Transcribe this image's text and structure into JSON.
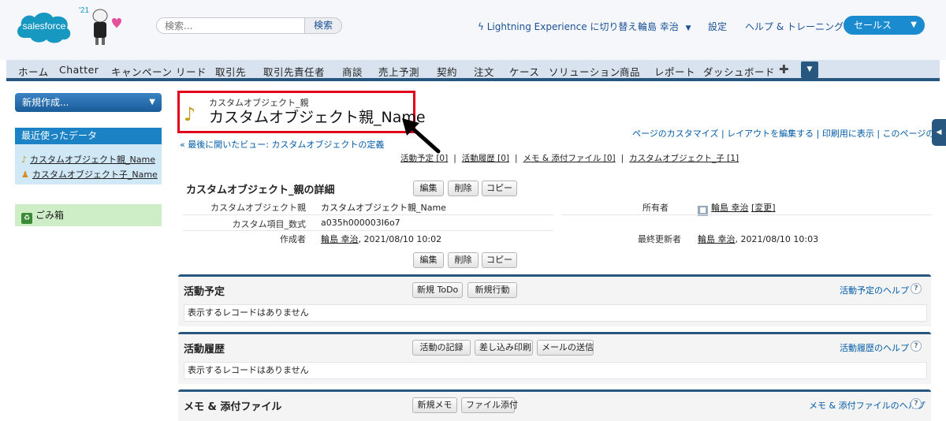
{
  "header": {
    "search_placeholder": "検索...",
    "search_button": "検索",
    "lightning_link": "Lightning Experience に切り替え",
    "user_name": "輪島 幸治",
    "setup": "設定",
    "help_training": "ヘルプ & トレーニング",
    "app_name": "セールス",
    "logo_text": "salesforce",
    "mascot_badge": "'21"
  },
  "tabs": [
    "ホーム",
    "Chatter",
    "キャンペーン",
    "リード",
    "取引先",
    "取引先責任者",
    "商談",
    "売上予測",
    "契約",
    "注文",
    "ケース",
    "ソリューション",
    "商品",
    "レポート",
    "ダッシュボード"
  ],
  "sidebar": {
    "new_label": "新規作成...",
    "recent_title": "最近使ったデータ",
    "recent_items": [
      "カスタムオブジェクト親_Name",
      "カスタムオブジェクト子_Name"
    ],
    "trash_label": "ごみ箱"
  },
  "record": {
    "object_label": "カスタムオブジェクト_親",
    "name": "カスタムオブジェクト親_Name",
    "back_link": "« 最後に開いたビュー: カスタムオブジェクトの定義",
    "page_links": "ページのカスタマイズ | レイアウトを編集する | 印刷用に表示 | このページのヘルプ",
    "related_links": [
      "活動予定 [0]",
      "活動履歴 [0]",
      "メモ & 添付ファイル [0]",
      "カスタムオブジェクト_子 [1]"
    ]
  },
  "detail": {
    "title": "カスタムオブジェクト_親の詳細",
    "buttons": [
      "編集",
      "削除",
      "コピー"
    ],
    "fields": {
      "name_label": "カスタムオブジェクト親",
      "name_value": "カスタムオブジェクト親_Name",
      "formula_label": "カスタム項目_数式",
      "formula_value": "a035h000003I6o7",
      "created_label": "作成者",
      "created_user": "輪島 幸治",
      "created_date": ", 2021/08/10 10:02",
      "owner_label": "所有者",
      "owner_value": "輪島 幸治",
      "owner_change": "[変更]",
      "modified_label": "最終更新者",
      "modified_user": "輪島 幸治",
      "modified_date": ", 2021/08/10 10:03"
    }
  },
  "sections": {
    "activities": {
      "title": "活動予定",
      "buttons": [
        "新規 ToDo",
        "新規行動"
      ],
      "help": "活動予定のヘルプ",
      "empty": "表示するレコードはありません"
    },
    "history": {
      "title": "活動履歴",
      "buttons": [
        "活動の記録",
        "差し込み印刷",
        "メールの送信"
      ],
      "help": "活動履歴のヘルプ",
      "empty": "表示するレコードはありません"
    },
    "notes": {
      "title": "メモ & 添付ファイル",
      "buttons": [
        "新規メモ",
        "ファイル添付"
      ],
      "help": "メモ & 添付ファイルのヘルプ"
    }
  },
  "colors": {
    "tab_bar": "#d8e3ef",
    "section_border": "#27577e",
    "highlight_border": "#e3001b",
    "link": "#015ba7"
  }
}
